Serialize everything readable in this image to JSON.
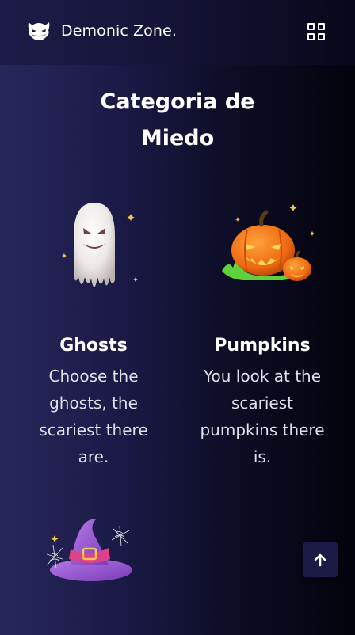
{
  "brand": {
    "logo_icon": "demon-face-icon",
    "name": "Demonic Zone."
  },
  "header": {
    "menu_icon": "grid-menu-icon"
  },
  "section": {
    "title_line1": "Categoria de",
    "title_line2": "Miedo"
  },
  "cards": [
    {
      "icon": "ghost-icon",
      "title": "Ghosts",
      "description": "Choose the ghosts, the scariest there are."
    },
    {
      "icon": "pumpkin-icon",
      "title": "Pumpkins",
      "description": "You look at the scariest pumpkins there is."
    },
    {
      "icon": "witch-hat-icon"
    }
  ],
  "scroll_top": {
    "icon": "arrow-up-icon"
  },
  "colors": {
    "background_left": "#28275c",
    "background_right": "#03030b",
    "scroll_button": "#1c1b46"
  }
}
